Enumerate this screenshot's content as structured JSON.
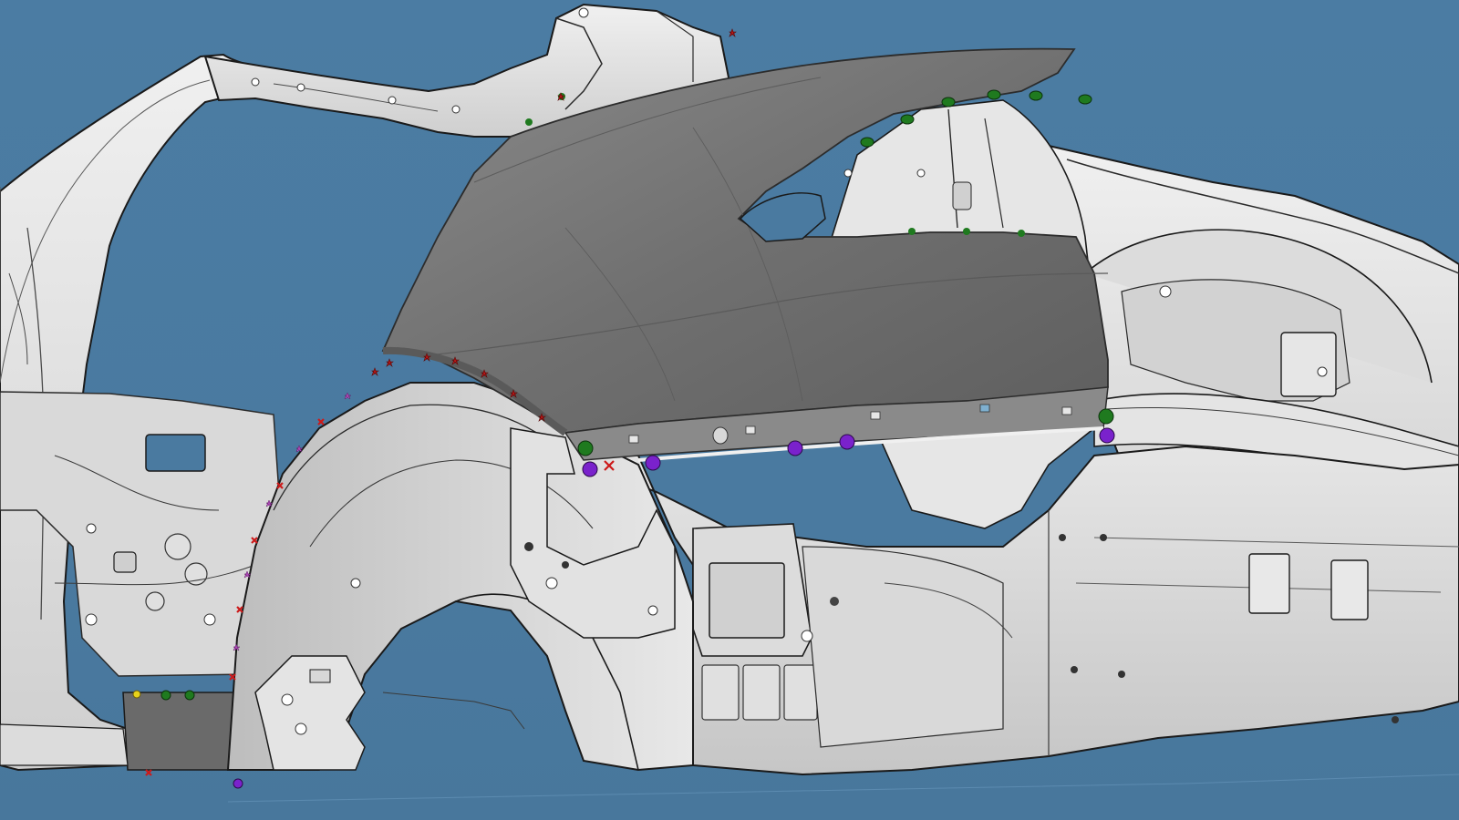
{
  "viewport": {
    "background_color": "#4a7aa0",
    "panel_color": "#6f6f6f",
    "body_color": "#e6e6e6",
    "edge_color": "#1a1a1a"
  },
  "markers": {
    "green": "#1f7a1f",
    "purple": "#7a22cc",
    "red": "#cc1a1a",
    "yellow": "#e8d21a",
    "pink": "#c85ad2"
  },
  "part_label": {
    "line1": "",
    "line2": ""
  }
}
